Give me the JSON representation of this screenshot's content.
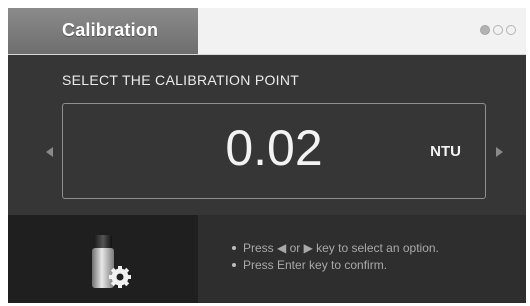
{
  "header": {
    "title": "Calibration",
    "pagination_dots": 3,
    "active_dot_index": 0
  },
  "main": {
    "prompt": "SELECT THE CALIBRATION POINT",
    "value": "0.02",
    "unit": "NTU",
    "prev_icon": "triangle-left",
    "next_icon": "triangle-right"
  },
  "footer": {
    "icon": "vial-gear-icon",
    "instructions": [
      "Press ◀ or ▶ key to select an option.",
      "Press Enter key to confirm."
    ]
  },
  "colors": {
    "title_tab": "#7d7d7d",
    "header_bg": "#f2f2f2",
    "main_bg": "#363636",
    "footer_bg": "#2e2e2e",
    "icon_panel_bg": "#1f1f1f",
    "text_light": "#f3f3f3",
    "text_muted": "#a9a9a9"
  }
}
